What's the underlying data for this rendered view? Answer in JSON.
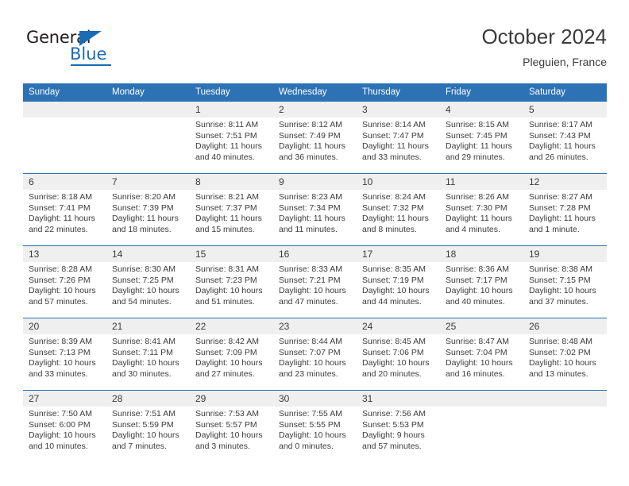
{
  "logo": {
    "text_primary": "General",
    "text_secondary": "Blue",
    "accent_color": "#1b6cb5"
  },
  "header": {
    "title": "October 2024",
    "location": "Pleguien, France",
    "header_bg_color": "#2d72b5",
    "daynum_bg_color": "#efefef"
  },
  "weekday_headers": [
    "Sunday",
    "Monday",
    "Tuesday",
    "Wednesday",
    "Thursday",
    "Friday",
    "Saturday"
  ],
  "labels": {
    "sunrise": "Sunrise:",
    "sunset": "Sunset:",
    "daylight": "Daylight:"
  },
  "weeks": [
    [
      {
        "day": "",
        "sunrise": "",
        "sunset": "",
        "daylight_a": "",
        "daylight_b": ""
      },
      {
        "day": "",
        "sunrise": "",
        "sunset": "",
        "daylight_a": "",
        "daylight_b": ""
      },
      {
        "day": "1",
        "sunrise": "Sunrise: 8:11 AM",
        "sunset": "Sunset: 7:51 PM",
        "daylight_a": "Daylight: 11 hours",
        "daylight_b": "and 40 minutes."
      },
      {
        "day": "2",
        "sunrise": "Sunrise: 8:12 AM",
        "sunset": "Sunset: 7:49 PM",
        "daylight_a": "Daylight: 11 hours",
        "daylight_b": "and 36 minutes."
      },
      {
        "day": "3",
        "sunrise": "Sunrise: 8:14 AM",
        "sunset": "Sunset: 7:47 PM",
        "daylight_a": "Daylight: 11 hours",
        "daylight_b": "and 33 minutes."
      },
      {
        "day": "4",
        "sunrise": "Sunrise: 8:15 AM",
        "sunset": "Sunset: 7:45 PM",
        "daylight_a": "Daylight: 11 hours",
        "daylight_b": "and 29 minutes."
      },
      {
        "day": "5",
        "sunrise": "Sunrise: 8:17 AM",
        "sunset": "Sunset: 7:43 PM",
        "daylight_a": "Daylight: 11 hours",
        "daylight_b": "and 26 minutes."
      }
    ],
    [
      {
        "day": "6",
        "sunrise": "Sunrise: 8:18 AM",
        "sunset": "Sunset: 7:41 PM",
        "daylight_a": "Daylight: 11 hours",
        "daylight_b": "and 22 minutes."
      },
      {
        "day": "7",
        "sunrise": "Sunrise: 8:20 AM",
        "sunset": "Sunset: 7:39 PM",
        "daylight_a": "Daylight: 11 hours",
        "daylight_b": "and 18 minutes."
      },
      {
        "day": "8",
        "sunrise": "Sunrise: 8:21 AM",
        "sunset": "Sunset: 7:37 PM",
        "daylight_a": "Daylight: 11 hours",
        "daylight_b": "and 15 minutes."
      },
      {
        "day": "9",
        "sunrise": "Sunrise: 8:23 AM",
        "sunset": "Sunset: 7:34 PM",
        "daylight_a": "Daylight: 11 hours",
        "daylight_b": "and 11 minutes."
      },
      {
        "day": "10",
        "sunrise": "Sunrise: 8:24 AM",
        "sunset": "Sunset: 7:32 PM",
        "daylight_a": "Daylight: 11 hours",
        "daylight_b": "and 8 minutes."
      },
      {
        "day": "11",
        "sunrise": "Sunrise: 8:26 AM",
        "sunset": "Sunset: 7:30 PM",
        "daylight_a": "Daylight: 11 hours",
        "daylight_b": "and 4 minutes."
      },
      {
        "day": "12",
        "sunrise": "Sunrise: 8:27 AM",
        "sunset": "Sunset: 7:28 PM",
        "daylight_a": "Daylight: 11 hours",
        "daylight_b": "and 1 minute."
      }
    ],
    [
      {
        "day": "13",
        "sunrise": "Sunrise: 8:28 AM",
        "sunset": "Sunset: 7:26 PM",
        "daylight_a": "Daylight: 10 hours",
        "daylight_b": "and 57 minutes."
      },
      {
        "day": "14",
        "sunrise": "Sunrise: 8:30 AM",
        "sunset": "Sunset: 7:25 PM",
        "daylight_a": "Daylight: 10 hours",
        "daylight_b": "and 54 minutes."
      },
      {
        "day": "15",
        "sunrise": "Sunrise: 8:31 AM",
        "sunset": "Sunset: 7:23 PM",
        "daylight_a": "Daylight: 10 hours",
        "daylight_b": "and 51 minutes."
      },
      {
        "day": "16",
        "sunrise": "Sunrise: 8:33 AM",
        "sunset": "Sunset: 7:21 PM",
        "daylight_a": "Daylight: 10 hours",
        "daylight_b": "and 47 minutes."
      },
      {
        "day": "17",
        "sunrise": "Sunrise: 8:35 AM",
        "sunset": "Sunset: 7:19 PM",
        "daylight_a": "Daylight: 10 hours",
        "daylight_b": "and 44 minutes."
      },
      {
        "day": "18",
        "sunrise": "Sunrise: 8:36 AM",
        "sunset": "Sunset: 7:17 PM",
        "daylight_a": "Daylight: 10 hours",
        "daylight_b": "and 40 minutes."
      },
      {
        "day": "19",
        "sunrise": "Sunrise: 8:38 AM",
        "sunset": "Sunset: 7:15 PM",
        "daylight_a": "Daylight: 10 hours",
        "daylight_b": "and 37 minutes."
      }
    ],
    [
      {
        "day": "20",
        "sunrise": "Sunrise: 8:39 AM",
        "sunset": "Sunset: 7:13 PM",
        "daylight_a": "Daylight: 10 hours",
        "daylight_b": "and 33 minutes."
      },
      {
        "day": "21",
        "sunrise": "Sunrise: 8:41 AM",
        "sunset": "Sunset: 7:11 PM",
        "daylight_a": "Daylight: 10 hours",
        "daylight_b": "and 30 minutes."
      },
      {
        "day": "22",
        "sunrise": "Sunrise: 8:42 AM",
        "sunset": "Sunset: 7:09 PM",
        "daylight_a": "Daylight: 10 hours",
        "daylight_b": "and 27 minutes."
      },
      {
        "day": "23",
        "sunrise": "Sunrise: 8:44 AM",
        "sunset": "Sunset: 7:07 PM",
        "daylight_a": "Daylight: 10 hours",
        "daylight_b": "and 23 minutes."
      },
      {
        "day": "24",
        "sunrise": "Sunrise: 8:45 AM",
        "sunset": "Sunset: 7:06 PM",
        "daylight_a": "Daylight: 10 hours",
        "daylight_b": "and 20 minutes."
      },
      {
        "day": "25",
        "sunrise": "Sunrise: 8:47 AM",
        "sunset": "Sunset: 7:04 PM",
        "daylight_a": "Daylight: 10 hours",
        "daylight_b": "and 16 minutes."
      },
      {
        "day": "26",
        "sunrise": "Sunrise: 8:48 AM",
        "sunset": "Sunset: 7:02 PM",
        "daylight_a": "Daylight: 10 hours",
        "daylight_b": "and 13 minutes."
      }
    ],
    [
      {
        "day": "27",
        "sunrise": "Sunrise: 7:50 AM",
        "sunset": "Sunset: 6:00 PM",
        "daylight_a": "Daylight: 10 hours",
        "daylight_b": "and 10 minutes."
      },
      {
        "day": "28",
        "sunrise": "Sunrise: 7:51 AM",
        "sunset": "Sunset: 5:59 PM",
        "daylight_a": "Daylight: 10 hours",
        "daylight_b": "and 7 minutes."
      },
      {
        "day": "29",
        "sunrise": "Sunrise: 7:53 AM",
        "sunset": "Sunset: 5:57 PM",
        "daylight_a": "Daylight: 10 hours",
        "daylight_b": "and 3 minutes."
      },
      {
        "day": "30",
        "sunrise": "Sunrise: 7:55 AM",
        "sunset": "Sunset: 5:55 PM",
        "daylight_a": "Daylight: 10 hours",
        "daylight_b": "and 0 minutes."
      },
      {
        "day": "31",
        "sunrise": "Sunrise: 7:56 AM",
        "sunset": "Sunset: 5:53 PM",
        "daylight_a": "Daylight: 9 hours",
        "daylight_b": "and 57 minutes."
      },
      {
        "day": "",
        "sunrise": "",
        "sunset": "",
        "daylight_a": "",
        "daylight_b": ""
      },
      {
        "day": "",
        "sunrise": "",
        "sunset": "",
        "daylight_a": "",
        "daylight_b": ""
      }
    ]
  ]
}
